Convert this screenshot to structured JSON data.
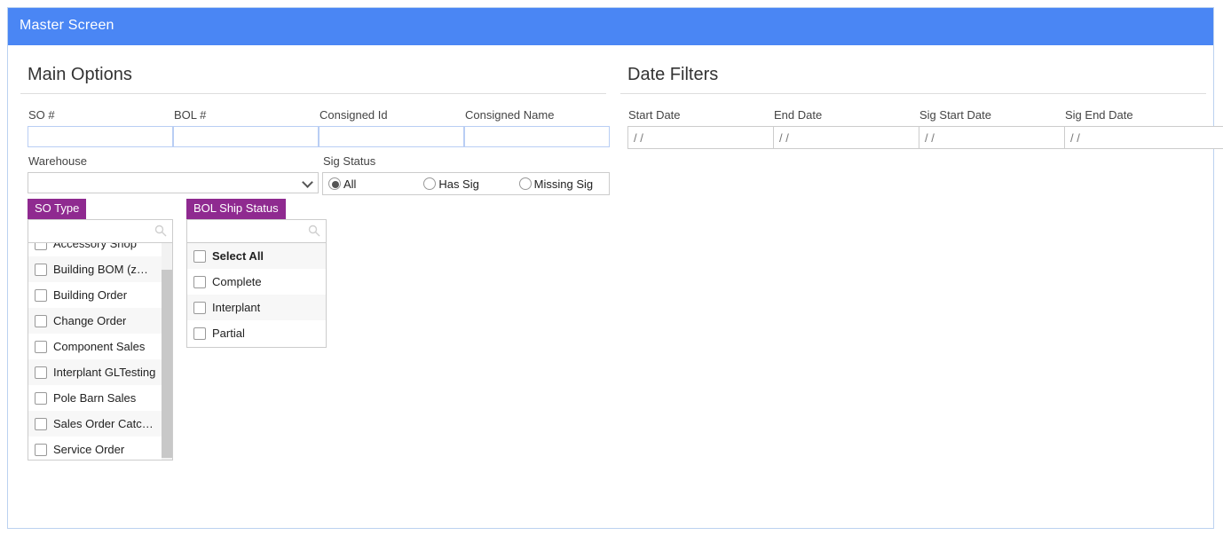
{
  "window": {
    "title": "Master Screen"
  },
  "sections": {
    "main_options": {
      "title": "Main Options"
    },
    "date_filters": {
      "title": "Date Filters"
    }
  },
  "main_options": {
    "fields": [
      {
        "label": "SO #",
        "value": "",
        "placeholder": ""
      },
      {
        "label": "BOL #",
        "value": "",
        "placeholder": ""
      },
      {
        "label": "Consigned Id",
        "value": "",
        "placeholder": ""
      },
      {
        "label": "Consigned Name",
        "value": "",
        "placeholder": ""
      }
    ],
    "warehouse": {
      "label": "Warehouse",
      "selected": "",
      "options": [
        ""
      ]
    },
    "sig_status": {
      "label": "Sig Status",
      "selected": "All",
      "options": [
        {
          "label": "All",
          "checked": true
        },
        {
          "label": "Has Sig",
          "checked": false
        },
        {
          "label": "Missing Sig",
          "checked": false
        }
      ]
    },
    "so_type": {
      "tab_label": "SO Type",
      "search_value": "",
      "search_placeholder": "",
      "search_icon": "search-icon",
      "items": [
        {
          "label": "Accessory Shop",
          "checked": false,
          "bold": false
        },
        {
          "label": "Building BOM (z…",
          "checked": false,
          "bold": false
        },
        {
          "label": "Building Order",
          "checked": false,
          "bold": false
        },
        {
          "label": "Change Order",
          "checked": false,
          "bold": false
        },
        {
          "label": "Component Sales",
          "checked": false,
          "bold": false
        },
        {
          "label": "Interplant GLTesting",
          "checked": false,
          "bold": false
        },
        {
          "label": "Pole Barn Sales",
          "checked": false,
          "bold": false
        },
        {
          "label": "Sales Order Catc…",
          "checked": false,
          "bold": false
        },
        {
          "label": "Service Order",
          "checked": false,
          "bold": false
        }
      ]
    },
    "bol_ship_status": {
      "tab_label": "BOL Ship Status",
      "search_value": "",
      "search_placeholder": "",
      "search_icon": "search-icon",
      "items": [
        {
          "label": "Select All",
          "checked": false,
          "bold": true
        },
        {
          "label": "Complete",
          "checked": false,
          "bold": false
        },
        {
          "label": "Interplant",
          "checked": false,
          "bold": false
        },
        {
          "label": "Partial",
          "checked": false,
          "bold": false
        }
      ]
    }
  },
  "date_filters": {
    "fields": [
      {
        "label": "Start Date",
        "value": "",
        "placeholder": "/ /",
        "icon": "calendar-icon"
      },
      {
        "label": "End Date",
        "value": "",
        "placeholder": "/ /",
        "icon": "calendar-icon"
      },
      {
        "label": "Sig Start Date",
        "value": "",
        "placeholder": "/ /",
        "icon": "calendar-icon"
      },
      {
        "label": "Sig End Date",
        "value": "",
        "placeholder": "/ /",
        "icon": "calendar-icon"
      }
    ]
  },
  "colors": {
    "titlebar": "#4a86f4",
    "tab_purple": "#8f2a90",
    "input_border": "#b9cef4",
    "panel_border": "#bcd2f0"
  }
}
